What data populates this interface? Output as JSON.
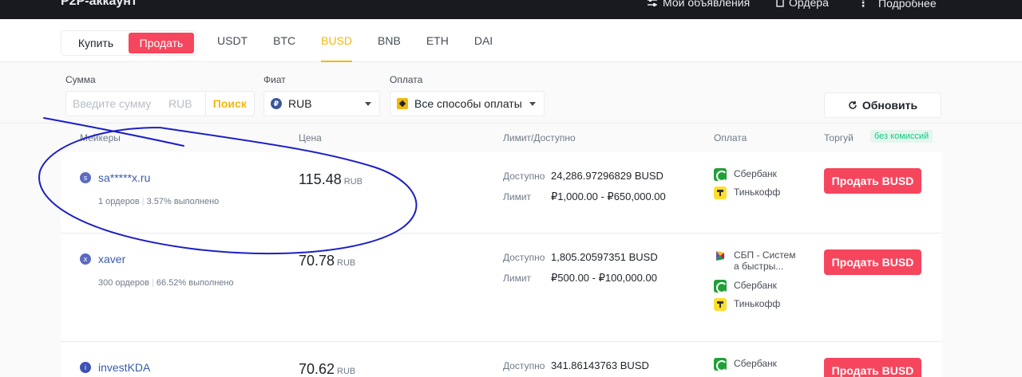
{
  "topbar": {
    "brand": "P2P-аккаунт",
    "my_ads": "Мои объявления",
    "orders": "Ордера",
    "more": "Подробнее"
  },
  "trade": {
    "buy_label": "Купить",
    "sell_label": "Продать"
  },
  "assets": [
    "USDT",
    "BTC",
    "BUSD",
    "BNB",
    "ETH",
    "DAI"
  ],
  "active_asset": "BUSD",
  "filters": {
    "amount_label": "Сумма",
    "amount_placeholder": "Введите сумму",
    "amount_currency": "RUB",
    "search_label": "Поиск",
    "fiat_label": "Фиат",
    "fiat_value": "RUB",
    "fiat_icon": "₽",
    "payment_label": "Оплата",
    "payment_value": "Все способы оплаты",
    "refresh_label": "Обновить"
  },
  "table": {
    "headers": {
      "makers": "Мейкеры",
      "price": "Цена",
      "limit": "Лимит/Доступно",
      "payment": "Оплата",
      "trade": "Торгуй",
      "no_fee": "без комиссий"
    },
    "available_label": "Доступно",
    "limit_label": "Лимит",
    "rows": [
      {
        "avatar": "s",
        "name": "sa*****x.ru",
        "orders": "1 ордеров",
        "completion": "3.57% выполнено",
        "price": "115.48",
        "price_unit": "RUB",
        "available": "24,286.97296829 BUSD",
        "limit": "₽1,000.00 - ₽650,000.00",
        "payments": [
          {
            "icon": "sberbank-icon",
            "label": "Сбербанк"
          },
          {
            "icon": "tinkoff-icon",
            "label": "Тинькофф"
          }
        ],
        "action": "Продать BUSD"
      },
      {
        "avatar": "x",
        "name": "xaver",
        "orders": "300 ордеров",
        "completion": "66.52% выполнено",
        "price": "70.78",
        "price_unit": "RUB",
        "available": "1,805.20597351 BUSD",
        "limit": "₽500.00 - ₽100,000.00",
        "payments": [
          {
            "icon": "sbp-icon",
            "label": "СБП - Систем",
            "label2": "а быстры..."
          },
          {
            "icon": "sberbank-icon",
            "label": "Сбербанк"
          },
          {
            "icon": "tinkoff-icon",
            "label": "Тинькофф"
          }
        ],
        "action": "Продать BUSD"
      },
      {
        "avatar": "i",
        "name": "investKDA",
        "price": "70.62",
        "price_unit": "RUB",
        "available": "341.86143763 BUSD",
        "payments": [
          {
            "icon": "sberbank-icon",
            "label": "Сбербанк"
          }
        ],
        "action": "Продать BUSD"
      }
    ]
  },
  "colors": {
    "accent": "#f0b90b",
    "sell": "#f6465d",
    "annotation": "#1d1fc4"
  }
}
